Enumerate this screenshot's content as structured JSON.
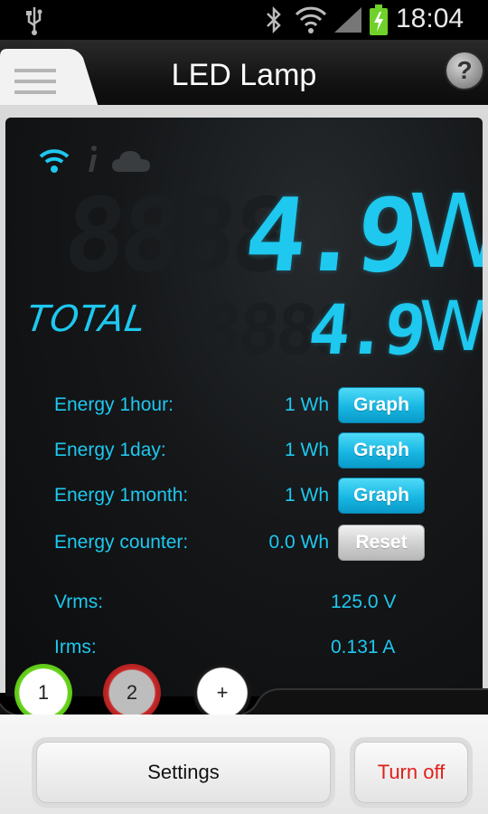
{
  "status_bar": {
    "time": "18:04",
    "icons": [
      "usb-icon",
      "bluetooth-icon",
      "wifi-icon",
      "signal-icon",
      "battery-charging-icon"
    ]
  },
  "header": {
    "title": "LED Lamp",
    "menu_icon": "hamburger-menu-icon",
    "help_label": "?"
  },
  "connection_icons": [
    "wifi-icon",
    "info-icon",
    "cloud-icon"
  ],
  "power": {
    "ghost_digits": "8888",
    "value": "4.9",
    "unit": "W"
  },
  "total": {
    "label": "TOTAL",
    "ghost_digits": "8888",
    "value": "4.9",
    "unit": "W"
  },
  "energy_rows": [
    {
      "label": "Energy 1hour:",
      "value": "1 Wh",
      "button": "Graph"
    },
    {
      "label": "Energy 1day:",
      "value": "1 Wh",
      "button": "Graph"
    },
    {
      "label": "Energy 1month:",
      "value": "1 Wh",
      "button": "Graph"
    },
    {
      "label": "Energy counter:",
      "value": "0.0 Wh",
      "button": "Reset"
    }
  ],
  "meters": [
    {
      "label": "Vrms:",
      "value": "125.0 V"
    },
    {
      "label": "Irms:",
      "value": "0.131 A"
    }
  ],
  "devices": [
    {
      "label": "1",
      "status": "active",
      "color": "#4fb80f"
    },
    {
      "label": "2",
      "status": "inactive",
      "color": "#c82a2a"
    },
    {
      "label": "+",
      "status": "add",
      "color": "#000000"
    }
  ],
  "buttons": {
    "settings": "Settings",
    "turn_off": "Turn off"
  },
  "colors": {
    "accent": "#1ec8ef",
    "turn_off_text": "#e0201b",
    "panel_bg": "#151719"
  }
}
